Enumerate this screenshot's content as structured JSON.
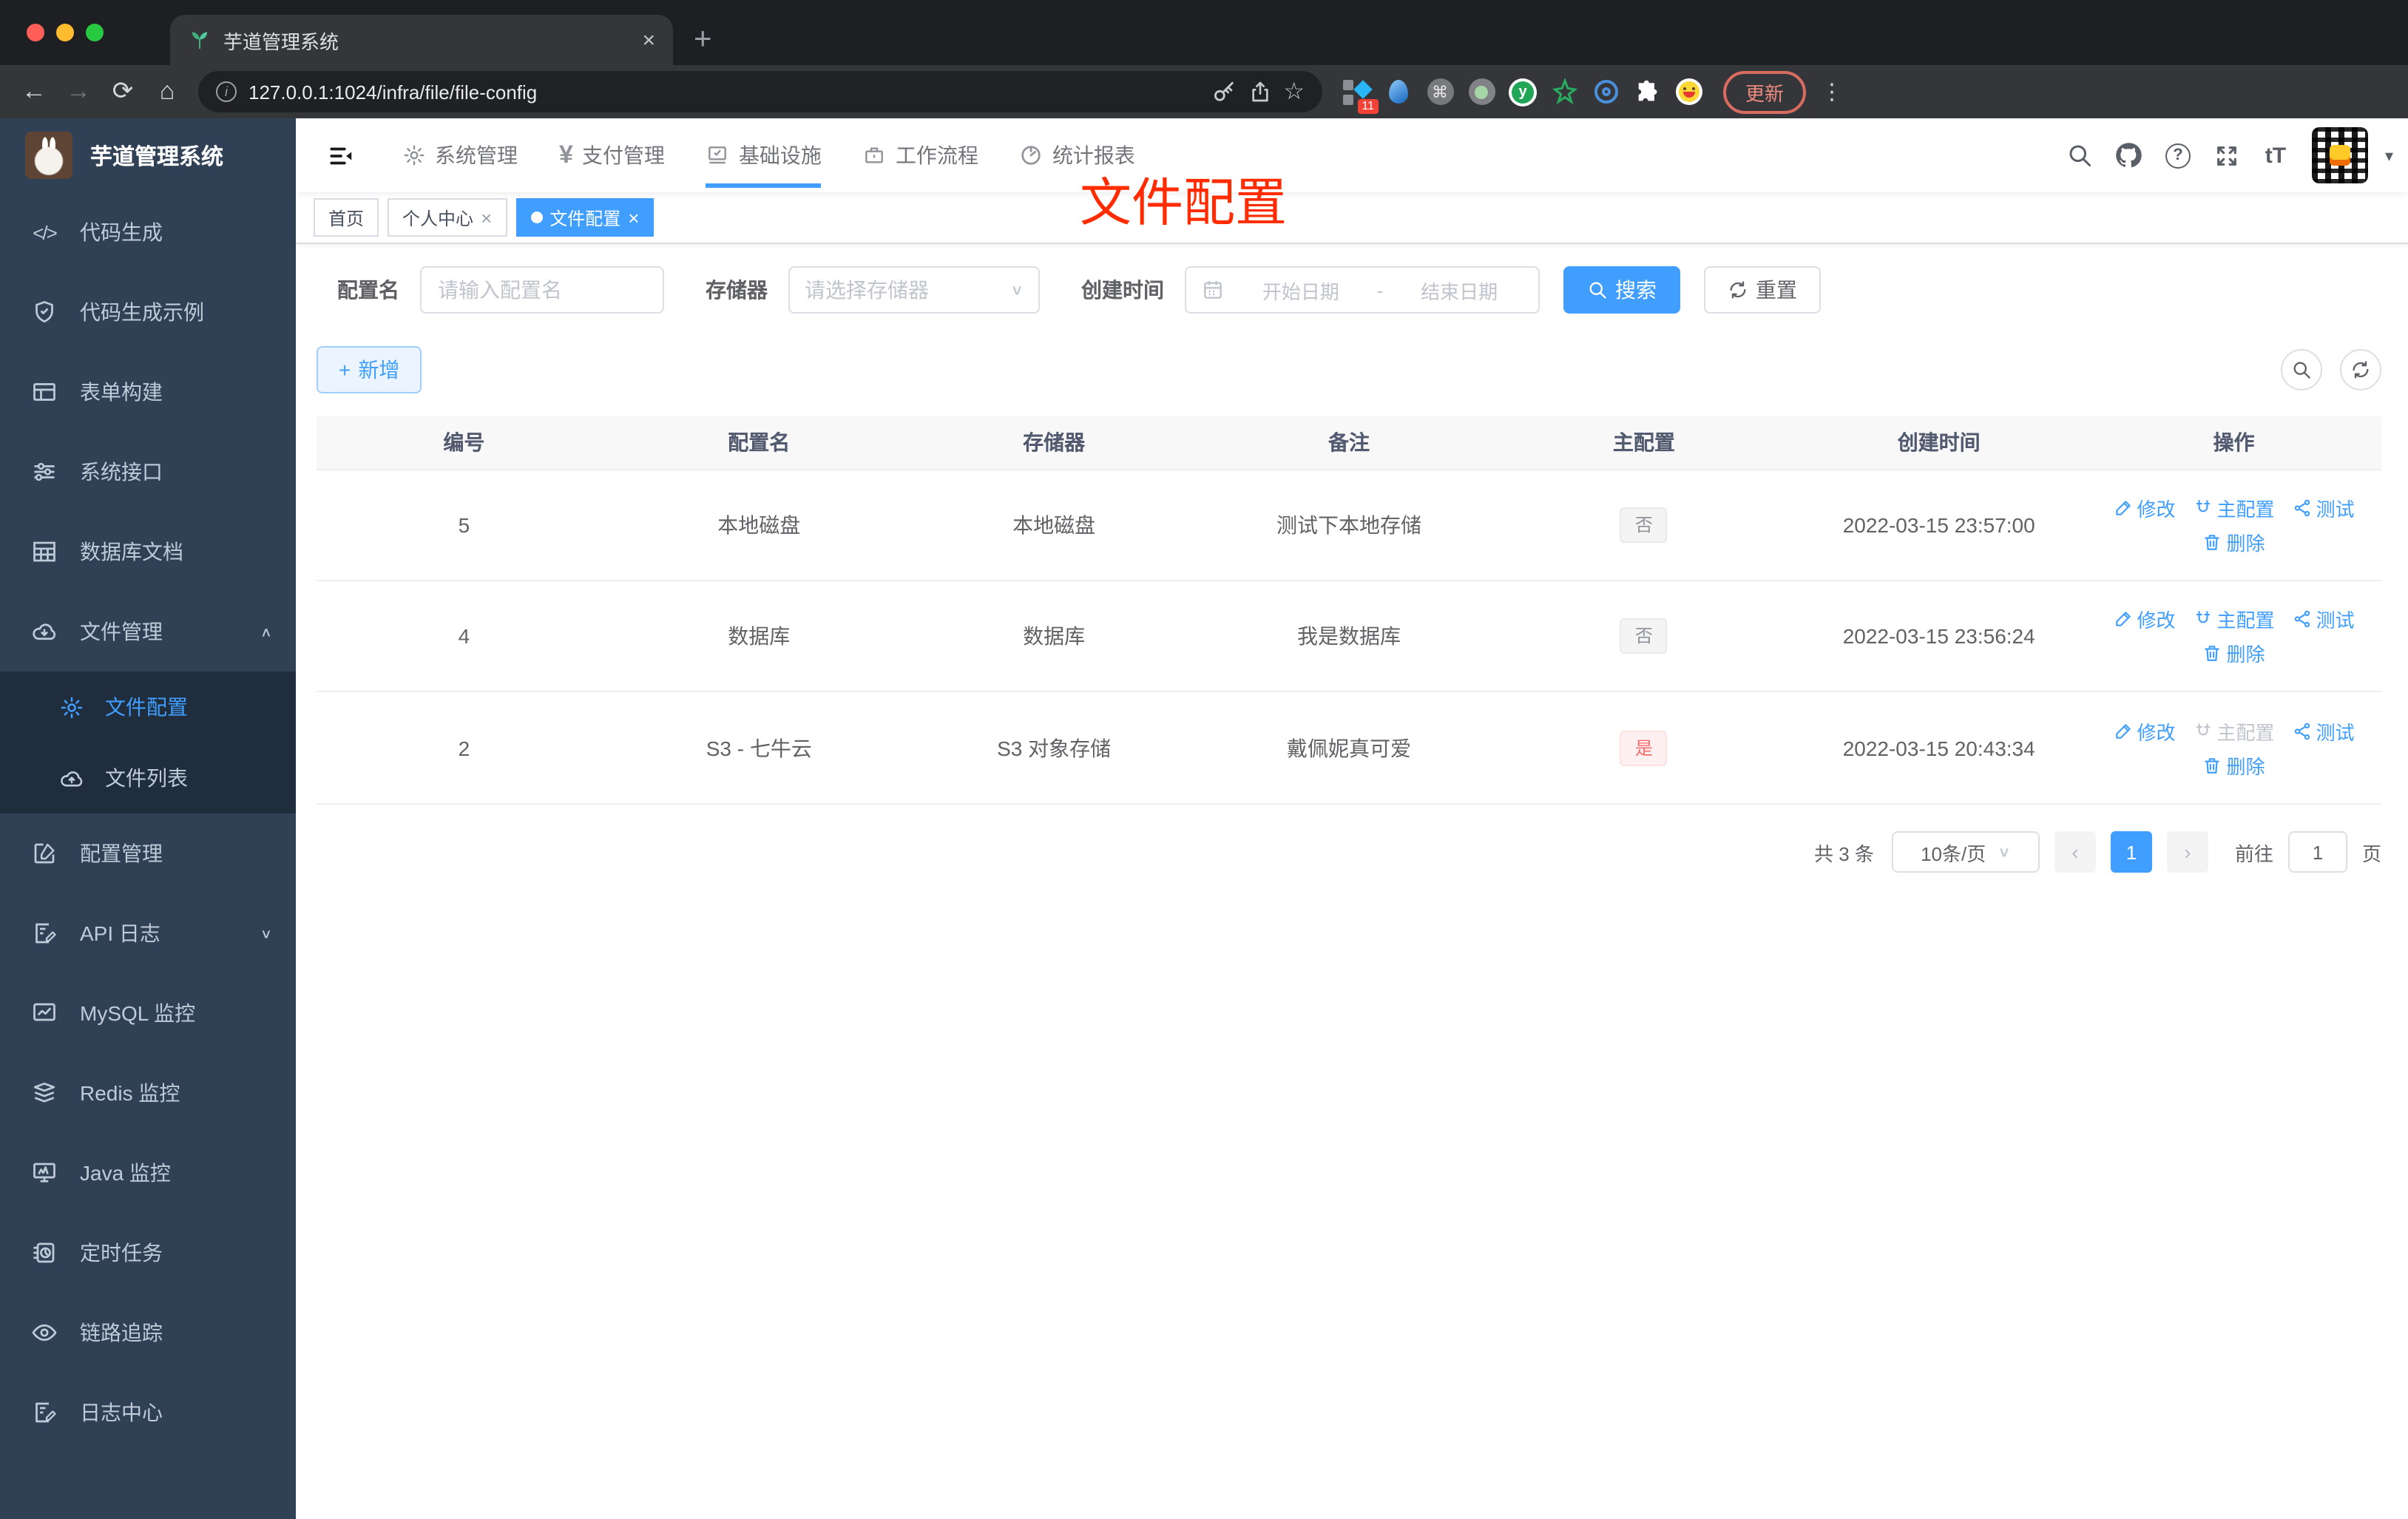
{
  "browser": {
    "tab_title": "芋道管理系统",
    "url": "127.0.0.1:1024/infra/file/file-config",
    "update_label": "更新",
    "extension_badge": "11"
  },
  "glyphs": {
    "close": "×",
    "plus": "+",
    "chevron_down": "∨",
    "chevron_up": "∧",
    "caret_down": "▾",
    "prev": "‹",
    "next": "›",
    "dash": "-",
    "question": "?",
    "font_size": "tT",
    "code": "</>",
    "yen": "¥",
    "command": "⌘",
    "dots": "⋮",
    "star": "☆",
    "back": "←",
    "forward": "→",
    "reload": "⟳",
    "home": "⌂",
    "info": "i",
    "y_letter": "y"
  },
  "sidebar": {
    "title": "芋道管理系统",
    "items": [
      {
        "label": "代码生成"
      },
      {
        "label": "代码生成示例"
      },
      {
        "label": "表单构建"
      },
      {
        "label": "系统接口"
      },
      {
        "label": "数据库文档"
      },
      {
        "label": "文件管理"
      },
      {
        "label": "配置管理"
      },
      {
        "label": "API 日志"
      },
      {
        "label": "MySQL 监控"
      },
      {
        "label": "Redis 监控"
      },
      {
        "label": "Java 监控"
      },
      {
        "label": "定时任务"
      },
      {
        "label": "链路追踪"
      },
      {
        "label": "日志中心"
      }
    ],
    "submenu": [
      {
        "label": "文件配置"
      },
      {
        "label": "文件列表"
      }
    ]
  },
  "topnav": {
    "items": [
      {
        "label": "系统管理"
      },
      {
        "label": "支付管理"
      },
      {
        "label": "基础设施"
      },
      {
        "label": "工作流程"
      },
      {
        "label": "统计报表"
      }
    ]
  },
  "tags": {
    "items": [
      {
        "label": "首页"
      },
      {
        "label": "个人中心"
      },
      {
        "label": "文件配置"
      }
    ]
  },
  "annotation": {
    "text": "文件配置"
  },
  "filters": {
    "name_label": "配置名",
    "name_placeholder": "请输入配置名",
    "storage_label": "存储器",
    "storage_placeholder": "请选择存储器",
    "date_label": "创建时间",
    "date_start": "开始日期",
    "date_end": "结束日期",
    "search_label": "搜索",
    "reset_label": "重置"
  },
  "toolbar": {
    "add_label": "新增"
  },
  "table": {
    "headers": [
      "编号",
      "配置名",
      "存储器",
      "备注",
      "主配置",
      "创建时间",
      "操作"
    ],
    "actions": {
      "edit": "修改",
      "master": "主配置",
      "test": "测试",
      "delete": "删除"
    },
    "rows": [
      {
        "id": "5",
        "name": "本地磁盘",
        "storage": "本地磁盘",
        "remark": "测试下本地存储",
        "master": "否",
        "time": "2022-03-15 23:57:00"
      },
      {
        "id": "4",
        "name": "数据库",
        "storage": "数据库",
        "remark": "我是数据库",
        "master": "否",
        "time": "2022-03-15 23:56:24"
      },
      {
        "id": "2",
        "name": "S3 - 七牛云",
        "storage": "S3 对象存储",
        "remark": "戴佩妮真可爱",
        "master": "是",
        "time": "2022-03-15 20:43:34"
      }
    ]
  },
  "pagination": {
    "total": "共 3 条",
    "size": "10条/页",
    "page": "1",
    "goto": "前往",
    "goto_value": "1",
    "unit": "页"
  },
  "colors": {
    "accent": "#409eff",
    "danger": "#f56c6c",
    "annotation": "#ff2b01",
    "sidebar": "#304156"
  }
}
